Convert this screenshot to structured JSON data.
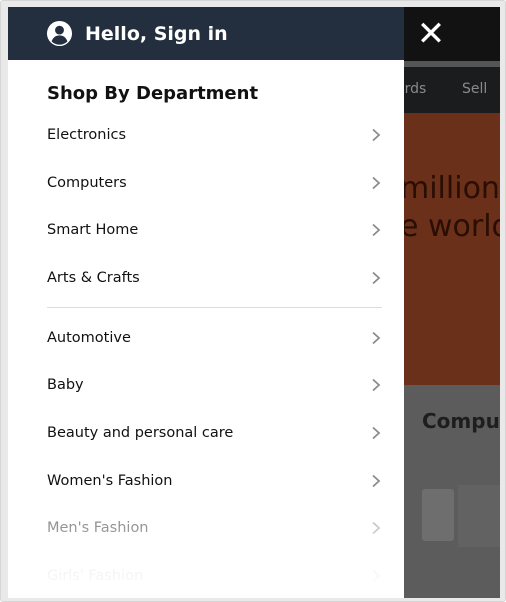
{
  "drawer": {
    "greeting": "Hello, Sign in",
    "avatar_icon": "user-circle-icon",
    "section_title": "Shop By Department",
    "items_group_1": [
      {
        "label": "Electronics"
      },
      {
        "label": "Computers"
      },
      {
        "label": "Smart Home"
      },
      {
        "label": "Arts & Crafts"
      }
    ],
    "items_group_2": [
      {
        "label": "Automotive"
      },
      {
        "label": "Baby"
      },
      {
        "label": "Beauty and personal care"
      },
      {
        "label": "Women's Fashion"
      },
      {
        "label": "Men's Fashion"
      },
      {
        "label": "Girls' Fashion"
      }
    ],
    "chevron_icon": "chevron-right-icon",
    "header_color": "#232f3e"
  },
  "close": {
    "icon": "close-icon",
    "glyph": "✕"
  },
  "background_page": {
    "nav_items": [
      "ards",
      "Sell"
    ],
    "hero_lines": [
      "million",
      "e world"
    ],
    "card_title": "Compu",
    "hero_color": "#6b3019"
  }
}
